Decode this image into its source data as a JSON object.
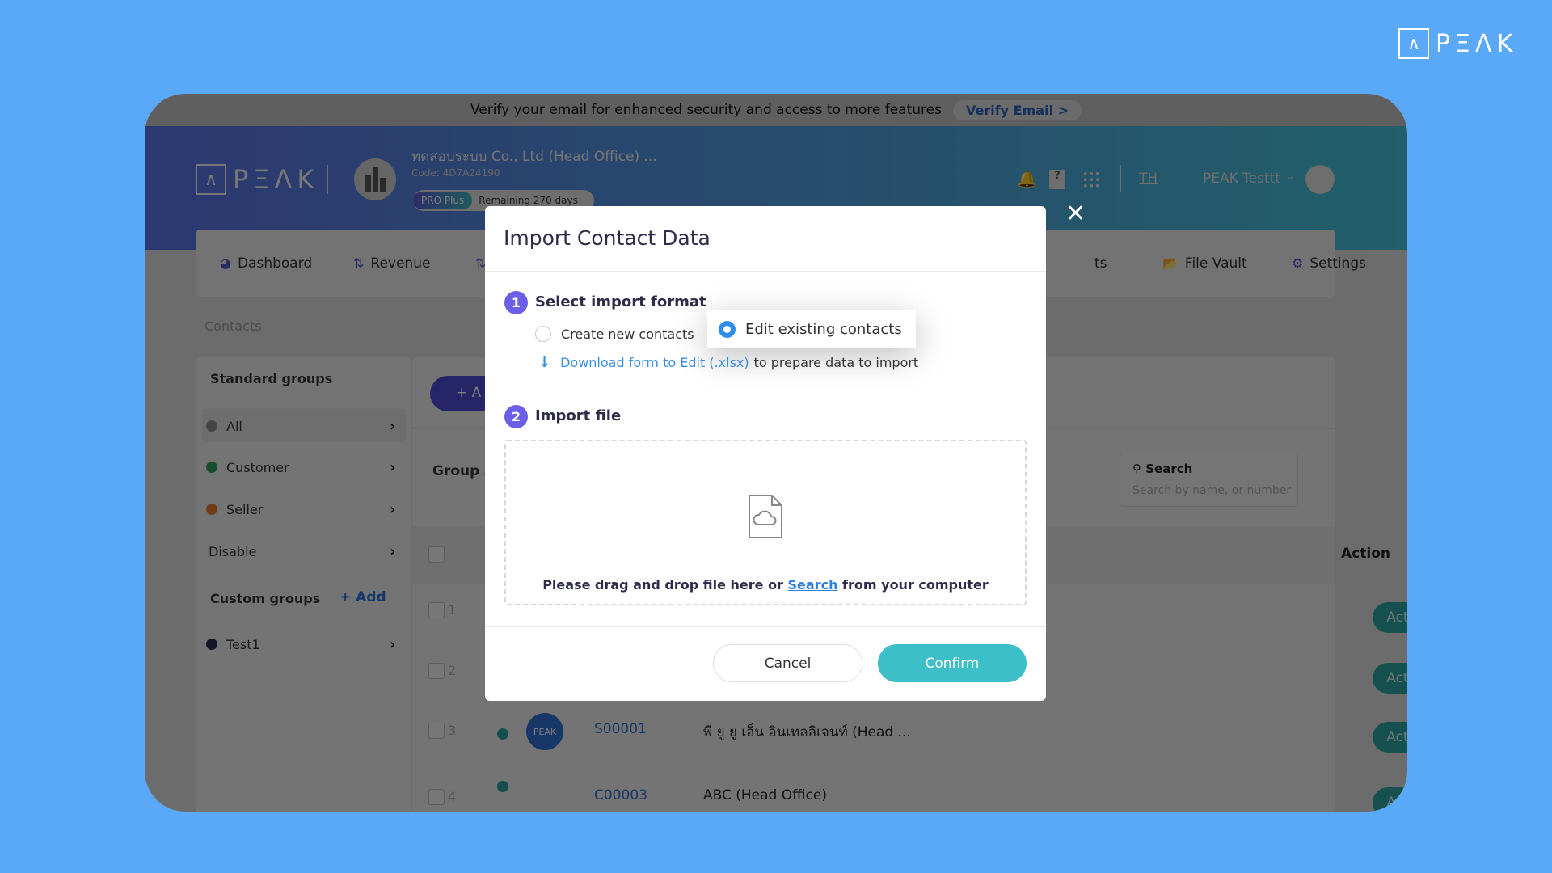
{
  "brand_logo": "PEAK",
  "verify_bar": {
    "message": "Verify your email for enhanced security and access to more features",
    "button": "Verify Email >"
  },
  "header": {
    "logo": "PEAK",
    "company_name": "ทดสอบระบบ Co., Ltd (Head Office) ...",
    "company_code": "Code: 4D7A24190",
    "plan": "PRO Plus",
    "remaining": "Remaining 270 days",
    "language": "TH",
    "user_name": "PEAK Testtt"
  },
  "nav": {
    "dashboard": "Dashboard",
    "revenue": "Revenue",
    "partial": "ts",
    "file_vault": "File Vault",
    "settings": "Settings"
  },
  "breadcrumb": "Contacts",
  "sidebar": {
    "standard_title": "Standard groups",
    "items": [
      {
        "label": "All",
        "color": "#8a8a8a"
      },
      {
        "label": "Customer",
        "color": "#2e9e5b"
      },
      {
        "label": "Seller",
        "color": "#e07b2c"
      },
      {
        "label": "Disable"
      }
    ],
    "custom_title": "Custom groups",
    "add": "Add",
    "custom_items": [
      {
        "label": "Test1",
        "color": "#2a2a55"
      }
    ]
  },
  "main": {
    "add_button": "+ A",
    "group_label": "Group A",
    "search_label": "Search",
    "search_placeholder": "Search by name, or number",
    "action_header": "Action",
    "rows": [
      {
        "num": "1",
        "action": "Action"
      },
      {
        "num": "2",
        "action": "Action"
      },
      {
        "num": "3",
        "code": "S00001",
        "name": "พี ยู ยู เอ็น อินเทลลิเจนท์ (Head ...",
        "avatar": "PEAK",
        "action": "Action"
      },
      {
        "num": "4",
        "code": "C00003",
        "name": "ABC (Head Office)",
        "action": "Action"
      }
    ]
  },
  "modal": {
    "title": "Import Contact Data",
    "step1_num": "1",
    "step1_label": "Select import format",
    "option_create": "Create new contacts",
    "option_edit": "Edit existing contacts",
    "selected": "Edit existing contacts",
    "download_link": "Download form to Edit (.xlsx)",
    "download_suffix": "to prepare data to import",
    "step2_num": "2",
    "step2_label": "Import file",
    "drop_prefix": "Please drag and drop file here or",
    "drop_link": "Search",
    "drop_suffix": "from your computer",
    "cancel": "Cancel",
    "confirm": "Confirm"
  },
  "colors": {
    "accent": "#6c5fe6",
    "confirm": "#3dbfc9",
    "link": "#3a8de0",
    "background": "#5aa8f8"
  }
}
